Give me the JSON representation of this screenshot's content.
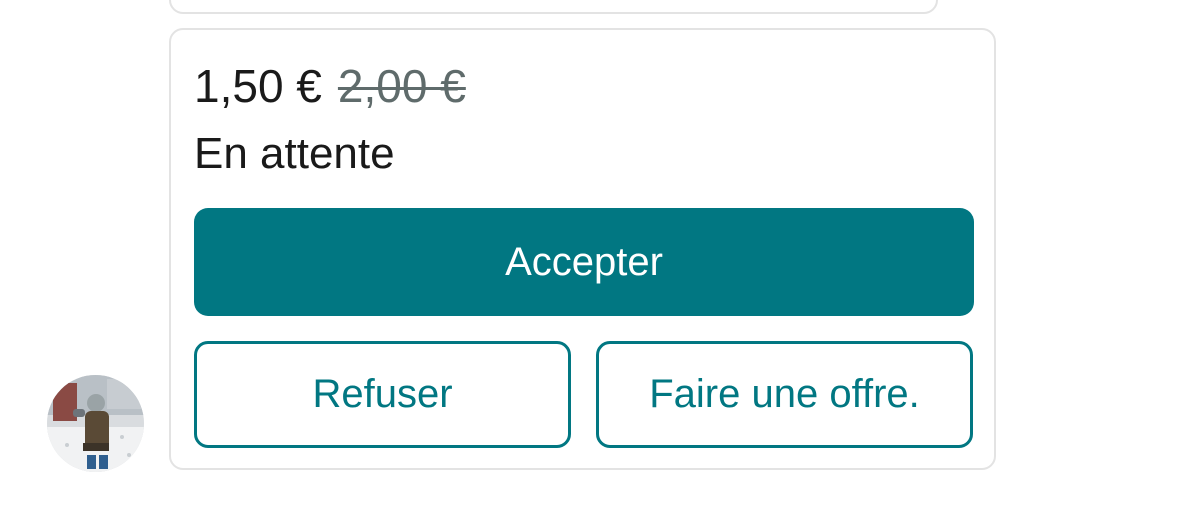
{
  "offer": {
    "price_current": "1,50 €",
    "price_original": "2,00 €",
    "status": "En attente",
    "accept_label": "Accepter",
    "refuse_label": "Refuser",
    "counter_offer_label": "Faire une offre."
  },
  "avatar": {
    "icon": "user-avatar-photo"
  },
  "colors": {
    "accent": "#017782",
    "text": "#1a1a1a",
    "strikethrough_text": "#5f6b6b",
    "card_border": "#e3e3e3"
  }
}
